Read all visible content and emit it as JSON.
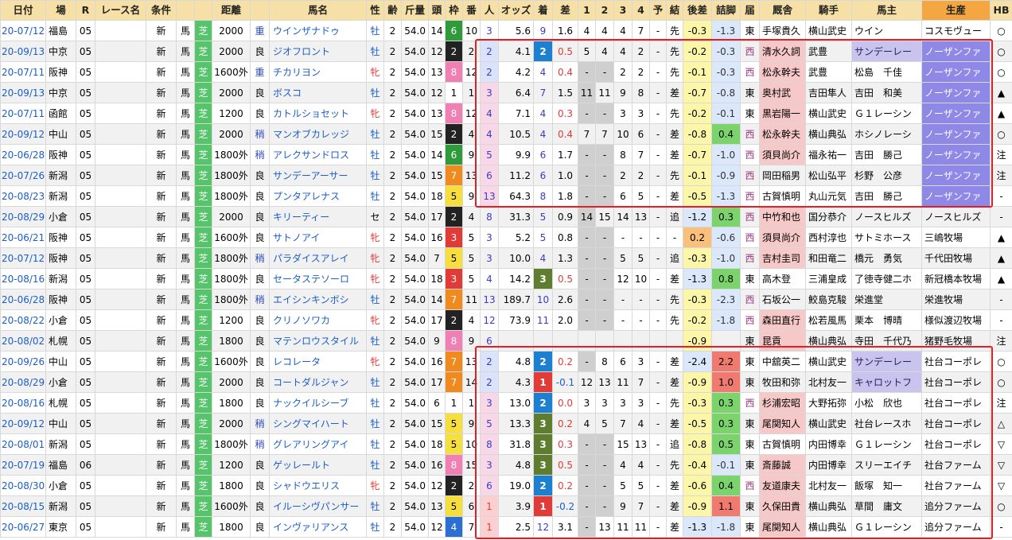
{
  "headers": [
    "日付",
    "場",
    "R",
    "レース名",
    "条件",
    "",
    "",
    "距離",
    "",
    "馬名",
    "性",
    "齢",
    "斤量",
    "頭",
    "枠",
    "番",
    "人",
    "オッズ",
    "着",
    "差",
    "1",
    "2",
    "3",
    "4",
    "予",
    "結",
    "後差",
    "詰脚",
    "届",
    "厩舎",
    "騎手",
    "馬主",
    "生産",
    "HB"
  ],
  "rows": [
    {
      "date": "20-07/12",
      "place": "福島",
      "r": "05",
      "race": "",
      "cond": "新",
      "type": "馬",
      "surf": "芝",
      "dist": "2000",
      "tr": "重",
      "horse": "ウインザナドゥ",
      "sex": "牡",
      "age": "2",
      "kin": "54.0",
      "tou": "14",
      "waku": "6",
      "ban": "10",
      "pop": "3",
      "odds": "5.6",
      "chaku": "9",
      "diff": "1.6",
      "c1": "4",
      "c2": "4",
      "c3": "4",
      "c4": "7",
      "yo": "-",
      "ketsu": "先",
      "atosa": "-0.3",
      "tsume": "-1.3",
      "todo": "東",
      "stable": "手塚貴久",
      "jockey": "横山武史",
      "owner": "ウイン",
      "breeder": "コスモヴュー",
      "hb": "○"
    },
    {
      "date": "20-09/13",
      "place": "中京",
      "r": "05",
      "race": "",
      "cond": "新",
      "type": "馬",
      "surf": "芝",
      "dist": "2000",
      "tr": "良",
      "horse": "ジオフロント",
      "sex": "牡",
      "age": "2",
      "kin": "54.0",
      "tou": "12",
      "waku": "2",
      "ban": "2",
      "pop": "2",
      "odds": "4.1",
      "chaku": "2",
      "diff": "0.5",
      "c1": "5",
      "c2": "4",
      "c3": "4",
      "c4": "2",
      "yo": "-",
      "ketsu": "先",
      "atosa": "-0.2",
      "tsume": "-0.3",
      "todo": "西",
      "stable": "清水久詞",
      "jockey": "武豊",
      "owner": "サンデーレー",
      "breeder": "ノーザンファ",
      "hb": "○"
    },
    {
      "date": "20-07/11",
      "place": "阪神",
      "r": "05",
      "race": "",
      "cond": "新",
      "type": "馬",
      "surf": "芝",
      "dist": "1600外",
      "tr": "重",
      "horse": "チカリヨン",
      "sex": "牝",
      "age": "2",
      "kin": "54.0",
      "tou": "13",
      "waku": "8",
      "ban": "12",
      "pop": "2",
      "odds": "4.2",
      "chaku": "4",
      "diff": "0.4",
      "c1": "-",
      "c2": "-",
      "c3": "2",
      "c4": "2",
      "yo": "-",
      "ketsu": "先",
      "atosa": "-0.1",
      "tsume": "-0.3",
      "todo": "西",
      "stable": "松永幹夫",
      "jockey": "武豊",
      "owner": "松島　千佳",
      "breeder": "ノーザンファ",
      "hb": "○"
    },
    {
      "date": "20-09/13",
      "place": "中京",
      "r": "05",
      "race": "",
      "cond": "新",
      "type": "馬",
      "surf": "芝",
      "dist": "2000",
      "tr": "良",
      "horse": "ボスコ",
      "sex": "牡",
      "age": "2",
      "kin": "54.0",
      "tou": "12",
      "waku": "1",
      "ban": "1",
      "pop": "3",
      "odds": "6.4",
      "chaku": "7",
      "diff": "1.5",
      "c1": "11",
      "c2": "11",
      "c3": "9",
      "c4": "8",
      "yo": "-",
      "ketsu": "差",
      "atosa": "-0.7",
      "tsume": "-0.8",
      "todo": "東",
      "stable": "奥村武",
      "jockey": "吉田隼人",
      "owner": "吉田　和美",
      "breeder": "ノーザンファ",
      "hb": "▲"
    },
    {
      "date": "20-07/11",
      "place": "函館",
      "r": "05",
      "race": "",
      "cond": "新",
      "type": "馬",
      "surf": "芝",
      "dist": "1200",
      "tr": "良",
      "horse": "カトルショセット",
      "sex": "牝",
      "age": "2",
      "kin": "54.0",
      "tou": "13",
      "waku": "8",
      "ban": "12",
      "pop": "4",
      "odds": "7.1",
      "chaku": "4",
      "diff": "0.3",
      "c1": "-",
      "c2": "-",
      "c3": "3",
      "c4": "3",
      "yo": "-",
      "ketsu": "先",
      "atosa": "-0.2",
      "tsume": "-0.1",
      "todo": "東",
      "stable": "黒岩陽一",
      "jockey": "横山武史",
      "owner": "Ｇ１レーシン",
      "breeder": "ノーザンファ",
      "hb": "▲"
    },
    {
      "date": "20-09/12",
      "place": "中山",
      "r": "05",
      "race": "",
      "cond": "新",
      "type": "馬",
      "surf": "芝",
      "dist": "2000",
      "tr": "稍",
      "horse": "マンオブカレッジ",
      "sex": "牡",
      "age": "2",
      "kin": "54.0",
      "tou": "15",
      "waku": "2",
      "ban": "4",
      "pop": "4",
      "odds": "10.5",
      "chaku": "4",
      "diff": "0.4",
      "c1": "7",
      "c2": "7",
      "c3": "10",
      "c4": "6",
      "yo": "-",
      "ketsu": "差",
      "atosa": "-0.8",
      "tsume": "0.4",
      "todo": "西",
      "stable": "松永幹夫",
      "jockey": "横山典弘",
      "owner": "ホシノレーシ",
      "breeder": "ノーザンファ",
      "hb": "○"
    },
    {
      "date": "20-06/28",
      "place": "阪神",
      "r": "05",
      "race": "",
      "cond": "新",
      "type": "馬",
      "surf": "芝",
      "dist": "1800外",
      "tr": "稍",
      "horse": "アレクサンドロス",
      "sex": "牡",
      "age": "2",
      "kin": "54.0",
      "tou": "14",
      "waku": "6",
      "ban": "9",
      "pop": "5",
      "odds": "9.9",
      "chaku": "6",
      "diff": "1.7",
      "c1": "-",
      "c2": "-",
      "c3": "8",
      "c4": "7",
      "yo": "-",
      "ketsu": "差",
      "atosa": "-0.7",
      "tsume": "-1.0",
      "todo": "西",
      "stable": "須貝尚介",
      "jockey": "福永祐一",
      "owner": "吉田　勝己",
      "breeder": "ノーザンファ",
      "hb": "注"
    },
    {
      "date": "20-07/26",
      "place": "新潟",
      "r": "05",
      "race": "",
      "cond": "新",
      "type": "馬",
      "surf": "芝",
      "dist": "1800外",
      "tr": "良",
      "horse": "サンデーアーサー",
      "sex": "牡",
      "age": "2",
      "kin": "54.0",
      "tou": "15",
      "waku": "7",
      "ban": "13",
      "pop": "6",
      "odds": "11.2",
      "chaku": "6",
      "diff": "1.0",
      "c1": "-",
      "c2": "-",
      "c3": "2",
      "c4": "2",
      "yo": "-",
      "ketsu": "先",
      "atosa": "-0.1",
      "tsume": "-0.9",
      "todo": "西",
      "stable": "岡田稲男",
      "jockey": "松山弘平",
      "owner": "杉野　公彦",
      "breeder": "ノーザンファ",
      "hb": "注"
    },
    {
      "date": "20-08/23",
      "place": "新潟",
      "r": "05",
      "race": "",
      "cond": "新",
      "type": "馬",
      "surf": "芝",
      "dist": "1800外",
      "tr": "良",
      "horse": "プンタアレナス",
      "sex": "牡",
      "age": "2",
      "kin": "54.0",
      "tou": "18",
      "waku": "5",
      "ban": "9",
      "pop": "13",
      "odds": "64.3",
      "chaku": "8",
      "diff": "1.8",
      "c1": "-",
      "c2": "-",
      "c3": "6",
      "c4": "5",
      "yo": "-",
      "ketsu": "差",
      "atosa": "-0.5",
      "tsume": "-1.3",
      "todo": "西",
      "stable": "古賀慎明",
      "jockey": "丸山元気",
      "owner": "吉田　勝己",
      "breeder": "ノーザンファ",
      "hb": "-"
    },
    {
      "date": "20-08/29",
      "place": "小倉",
      "r": "05",
      "race": "",
      "cond": "新",
      "type": "馬",
      "surf": "芝",
      "dist": "2000",
      "tr": "良",
      "horse": "キリーティー",
      "sex": "セ",
      "age": "2",
      "kin": "54.0",
      "tou": "17",
      "waku": "2",
      "ban": "4",
      "pop": "8",
      "odds": "31.3",
      "chaku": "5",
      "diff": "0.9",
      "c1": "14",
      "c2": "15",
      "c3": "14",
      "c4": "13",
      "yo": "-",
      "ketsu": "追",
      "atosa": "-1.2",
      "tsume": "0.3",
      "todo": "西",
      "stable": "中竹和也",
      "jockey": "国分恭介",
      "owner": "ノースヒルズ",
      "breeder": "ノースヒルズ",
      "hb": "-"
    },
    {
      "date": "20-06/21",
      "place": "阪神",
      "r": "05",
      "race": "",
      "cond": "新",
      "type": "馬",
      "surf": "芝",
      "dist": "1600外",
      "tr": "良",
      "horse": "サトノアイ",
      "sex": "牝",
      "age": "2",
      "kin": "54.0",
      "tou": "16",
      "waku": "3",
      "ban": "5",
      "pop": "3",
      "odds": "5.2",
      "chaku": "5",
      "diff": "0.8",
      "c1": "-",
      "c2": "-",
      "c3": "-",
      "c4": "-",
      "yo": "-",
      "ketsu": "-",
      "atosa": "0.2",
      "tsume": "-0.6",
      "todo": "西",
      "stable": "須貝尚介",
      "jockey": "西村淳也",
      "owner": "サトミホース",
      "breeder": "三嶋牧場",
      "hb": "▲"
    },
    {
      "date": "20-07/12",
      "place": "阪神",
      "r": "05",
      "race": "",
      "cond": "新",
      "type": "馬",
      "surf": "芝",
      "dist": "1800外",
      "tr": "稍",
      "horse": "パラダイスアレイ",
      "sex": "牝",
      "age": "2",
      "kin": "54.0",
      "tou": "7",
      "waku": "5",
      "ban": "5",
      "pop": "3",
      "odds": "10.0",
      "chaku": "4",
      "diff": "1.3",
      "c1": "-",
      "c2": "-",
      "c3": "5",
      "c4": "5",
      "yo": "-",
      "ketsu": "追",
      "atosa": "-0.3",
      "tsume": "-1.0",
      "todo": "西",
      "stable": "吉村圭司",
      "jockey": "和田竜二",
      "owner": "橋元　勇気",
      "breeder": "千代田牧場",
      "hb": "▲"
    },
    {
      "date": "20-08/16",
      "place": "新潟",
      "r": "05",
      "race": "",
      "cond": "新",
      "type": "馬",
      "surf": "芝",
      "dist": "1800外",
      "tr": "良",
      "horse": "セータステソーロ",
      "sex": "牝",
      "age": "2",
      "kin": "54.0",
      "tou": "18",
      "waku": "3",
      "ban": "5",
      "pop": "4",
      "odds": "14.2",
      "chaku": "3",
      "diff": "0.5",
      "c1": "-",
      "c2": "-",
      "c3": "12",
      "c4": "10",
      "yo": "-",
      "ketsu": "差",
      "atosa": "-1.3",
      "tsume": "0.8",
      "todo": "東",
      "stable": "高木登",
      "jockey": "三浦皇成",
      "owner": "了徳寺健二ホ",
      "breeder": "新冠橋本牧場",
      "hb": "▲"
    },
    {
      "date": "20-06/28",
      "place": "阪神",
      "r": "05",
      "race": "",
      "cond": "新",
      "type": "馬",
      "surf": "芝",
      "dist": "1800外",
      "tr": "稍",
      "horse": "エイシンキンボシ",
      "sex": "牡",
      "age": "2",
      "kin": "54.0",
      "tou": "14",
      "waku": "7",
      "ban": "11",
      "pop": "13",
      "odds": "189.7",
      "chaku": "10",
      "diff": "2.6",
      "c1": "-",
      "c2": "-",
      "c3": "-",
      "c4": "-",
      "yo": "-",
      "ketsu": "先",
      "atosa": "-0.3",
      "tsume": "-2.3",
      "todo": "西",
      "stable": "石坂公一",
      "jockey": "鮫島克駿",
      "owner": "栄進堂",
      "breeder": "栄進牧場",
      "hb": "-"
    },
    {
      "date": "20-08/22",
      "place": "小倉",
      "r": "05",
      "race": "",
      "cond": "新",
      "type": "馬",
      "surf": "芝",
      "dist": "1200",
      "tr": "良",
      "horse": "クリノソワカ",
      "sex": "牝",
      "age": "2",
      "kin": "54.0",
      "tou": "17",
      "waku": "2",
      "ban": "4",
      "pop": "12",
      "odds": "73.9",
      "chaku": "11",
      "diff": "2.0",
      "c1": "-",
      "c2": "-",
      "c3": "-",
      "c4": "-",
      "yo": "-",
      "ketsu": "先",
      "atosa": "-0.2",
      "tsume": "-1.8",
      "todo": "西",
      "stable": "森田直行",
      "jockey": "松若風馬",
      "owner": "栗本　博晴",
      "breeder": "様似渡辺牧場",
      "hb": "-"
    },
    {
      "date": "20-08/02",
      "place": "札幌",
      "r": "05",
      "race": "",
      "cond": "新",
      "type": "馬",
      "surf": "芝",
      "dist": "1800",
      "tr": "良",
      "horse": "マテンロウスタイル",
      "sex": "牡",
      "age": "2",
      "kin": "54.0",
      "tou": "9",
      "waku": "8",
      "ban": "9",
      "pop": "6",
      "odds": "",
      "chaku": "",
      "diff": "",
      "c1": "",
      "c2": "",
      "c3": "",
      "c4": "",
      "yo": "",
      "ketsu": "",
      "atosa": "-0.9",
      "tsume": "",
      "todo": "東",
      "stable": "昆貢",
      "jockey": "横山典弘",
      "owner": "寺田　千代乃",
      "breeder": "猪野毛牧場",
      "hb": "注"
    },
    {
      "date": "20-09/26",
      "place": "中山",
      "r": "05",
      "race": "",
      "cond": "新",
      "type": "馬",
      "surf": "芝",
      "dist": "1600外",
      "tr": "良",
      "horse": "レコレータ",
      "sex": "牝",
      "age": "2",
      "kin": "54.0",
      "tou": "16",
      "waku": "7",
      "ban": "13",
      "pop": "2",
      "odds": "4.8",
      "chaku": "2",
      "diff": "0.2",
      "c1": "-",
      "c2": "8",
      "c3": "6",
      "c4": "3",
      "yo": "-",
      "ketsu": "差",
      "atosa": "-2.4",
      "tsume": "2.2",
      "todo": "東",
      "stable": "中舘英二",
      "jockey": "横山武史",
      "owner": "サンデーレー",
      "breeder": "社台コーポレ",
      "hb": "○"
    },
    {
      "date": "20-08/29",
      "place": "小倉",
      "r": "05",
      "race": "",
      "cond": "新",
      "type": "馬",
      "surf": "芝",
      "dist": "2000",
      "tr": "良",
      "horse": "コートダルジャン",
      "sex": "牡",
      "age": "2",
      "kin": "54.0",
      "tou": "17",
      "waku": "7",
      "ban": "14",
      "pop": "2",
      "odds": "4.3",
      "chaku": "1",
      "diff": "-0.1",
      "c1": "12",
      "c2": "13",
      "c3": "11",
      "c4": "7",
      "yo": "-",
      "ketsu": "差",
      "atosa": "-0.9",
      "tsume": "1.0",
      "todo": "東",
      "stable": "牧田和弥",
      "jockey": "北村友一",
      "owner": "キャロットフ",
      "breeder": "社台コーポレ",
      "hb": "○"
    },
    {
      "date": "20-08/16",
      "place": "札幌",
      "r": "05",
      "race": "",
      "cond": "新",
      "type": "馬",
      "surf": "芝",
      "dist": "1800",
      "tr": "良",
      "horse": "ナックイルシーブ",
      "sex": "牡",
      "age": "2",
      "kin": "54.0",
      "tou": "6",
      "waku": "1",
      "ban": "1",
      "pop": "3",
      "odds": "13.0",
      "chaku": "2",
      "diff": "0.0",
      "c1": "3",
      "c2": "3",
      "c3": "3",
      "c4": "3",
      "yo": "-",
      "ketsu": "先",
      "atosa": "-0.3",
      "tsume": "0.3",
      "todo": "西",
      "stable": "杉浦宏昭",
      "jockey": "大野拓弥",
      "owner": "小松　欣也",
      "breeder": "社台コーポレ",
      "hb": "注"
    },
    {
      "date": "20-09/12",
      "place": "中山",
      "r": "05",
      "race": "",
      "cond": "新",
      "type": "馬",
      "surf": "芝",
      "dist": "2000",
      "tr": "稍",
      "horse": "シングマイハート",
      "sex": "牡",
      "age": "2",
      "kin": "54.0",
      "tou": "15",
      "waku": "5",
      "ban": "9",
      "pop": "5",
      "odds": "13.3",
      "chaku": "3",
      "diff": "0.2",
      "c1": "4",
      "c2": "5",
      "c3": "7",
      "c4": "4",
      "yo": "-",
      "ketsu": "差",
      "atosa": "-0.5",
      "tsume": "0.3",
      "todo": "東",
      "stable": "尾関知人",
      "jockey": "横山武史",
      "owner": "社台レースホ",
      "breeder": "社台コーポレ",
      "hb": "△"
    },
    {
      "date": "20-08/01",
      "place": "新潟",
      "r": "05",
      "race": "",
      "cond": "新",
      "type": "馬",
      "surf": "芝",
      "dist": "1800外",
      "tr": "稍",
      "horse": "グレアリングアイ",
      "sex": "牡",
      "age": "2",
      "kin": "54.0",
      "tou": "18",
      "waku": "5",
      "ban": "10",
      "pop": "8",
      "odds": "31.8",
      "chaku": "3",
      "diff": "0.3",
      "c1": "-",
      "c2": "-",
      "c3": "15",
      "c4": "13",
      "yo": "-",
      "ketsu": "追",
      "atosa": "-0.8",
      "tsume": "0.5",
      "todo": "東",
      "stable": "古賀慎明",
      "jockey": "内田博幸",
      "owner": "Ｇ１レーシン",
      "breeder": "社台コーポレ",
      "hb": "▽"
    },
    {
      "date": "20-07/19",
      "place": "福島",
      "r": "06",
      "race": "",
      "cond": "新",
      "type": "馬",
      "surf": "芝",
      "dist": "1200",
      "tr": "良",
      "horse": "ゲッレールト",
      "sex": "牡",
      "age": "2",
      "kin": "54.0",
      "tou": "16",
      "waku": "8",
      "ban": "15",
      "pop": "3",
      "odds": "4.8",
      "chaku": "3",
      "diff": "0.5",
      "c1": "-",
      "c2": "-",
      "c3": "4",
      "c4": "4",
      "yo": "-",
      "ketsu": "先",
      "atosa": "-0.4",
      "tsume": "-0.1",
      "todo": "東",
      "stable": "斎藤誠",
      "jockey": "内田博幸",
      "owner": "スリーエイチ",
      "breeder": "社台ファーム",
      "hb": "▽"
    },
    {
      "date": "20-08/30",
      "place": "小倉",
      "r": "05",
      "race": "",
      "cond": "新",
      "type": "馬",
      "surf": "芝",
      "dist": "1800",
      "tr": "良",
      "horse": "シャドウエリス",
      "sex": "牝",
      "age": "2",
      "kin": "54.0",
      "tou": "12",
      "waku": "2",
      "ban": "2",
      "pop": "6",
      "odds": "19.0",
      "chaku": "2",
      "diff": "0.2",
      "c1": "-",
      "c2": "-",
      "c3": "5",
      "c4": "5",
      "yo": "-",
      "ketsu": "差",
      "atosa": "-0.6",
      "tsume": "0.4",
      "todo": "西",
      "stable": "友道康夫",
      "jockey": "北村友一",
      "owner": "飯塚　知一",
      "breeder": "社台ファーム",
      "hb": "▽"
    },
    {
      "date": "20-08/15",
      "place": "新潟",
      "r": "05",
      "race": "",
      "cond": "新",
      "type": "馬",
      "surf": "芝",
      "dist": "1600外",
      "tr": "良",
      "horse": "イルーシヴパンサー",
      "sex": "牡",
      "age": "2",
      "kin": "54.0",
      "tou": "13",
      "waku": "5",
      "ban": "6",
      "pop": "1",
      "odds": "3.9",
      "chaku": "1",
      "diff": "-0.2",
      "c1": "-",
      "c2": "-",
      "c3": "9",
      "c4": "7",
      "yo": "-",
      "ketsu": "差",
      "atosa": "-0.9",
      "tsume": "1.1",
      "todo": "東",
      "stable": "久保田貴",
      "jockey": "横山典弘",
      "owner": "草間　庸文",
      "breeder": "追分ファーム",
      "hb": "○"
    },
    {
      "date": "20-06/27",
      "place": "東京",
      "r": "05",
      "race": "",
      "cond": "新",
      "type": "馬",
      "surf": "芝",
      "dist": "1800",
      "tr": "良",
      "horse": "インヴァリアンス",
      "sex": "牡",
      "age": "2",
      "kin": "54.0",
      "tou": "12",
      "waku": "4",
      "ban": "7",
      "pop": "1",
      "odds": "2.5",
      "chaku": "12",
      "diff": "3.1",
      "c1": "-",
      "c2": "13",
      "c3": "11",
      "c4": "11",
      "yo": "-",
      "ketsu": "差",
      "atosa": "-1.3",
      "tsume": "-1.8",
      "todo": "東",
      "stable": "尾関知人",
      "jockey": "横山典弘",
      "owner": "Ｇ１レーシン",
      "breeder": "追分ファーム",
      "hb": "-"
    }
  ]
}
